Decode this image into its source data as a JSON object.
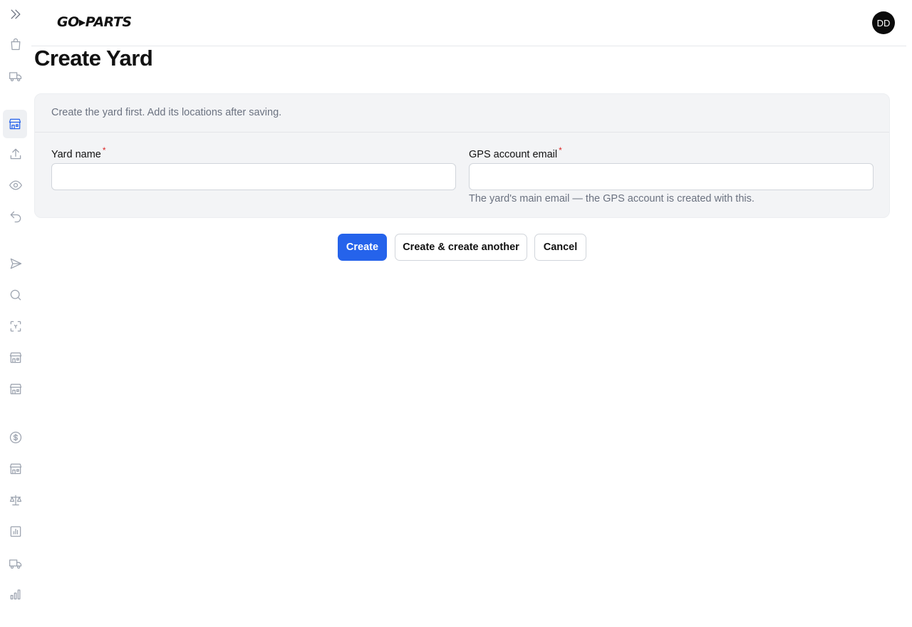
{
  "app": {
    "logo_text": "GO▸PARTS",
    "user_initials": "DD"
  },
  "sidebar": {
    "items": [
      {
        "icon": "chevrons-right-icon",
        "name": "sidebar-toggle"
      },
      {
        "icon": "shopping-bag-icon",
        "name": "sidebar-item-orders"
      },
      {
        "icon": "truck-icon",
        "name": "sidebar-item-shipping"
      },
      {
        "icon": "storefront-icon",
        "name": "sidebar-item-yards",
        "active": true
      },
      {
        "icon": "upload-icon",
        "name": "sidebar-item-upload"
      },
      {
        "icon": "eye-icon",
        "name": "sidebar-item-watch"
      },
      {
        "icon": "undo-icon",
        "name": "sidebar-item-returns"
      },
      {
        "icon": "send-icon",
        "name": "sidebar-item-send"
      },
      {
        "icon": "search-icon",
        "name": "sidebar-item-search"
      },
      {
        "icon": "scan-icon",
        "name": "sidebar-item-scan"
      },
      {
        "icon": "storefront-icon",
        "name": "sidebar-item-store-2"
      },
      {
        "icon": "storefront-icon",
        "name": "sidebar-item-store-3"
      },
      {
        "icon": "dollar-circle-icon",
        "name": "sidebar-item-payments"
      },
      {
        "icon": "storefront-icon",
        "name": "sidebar-item-store-4"
      },
      {
        "icon": "scale-icon",
        "name": "sidebar-item-disputes"
      },
      {
        "icon": "bar-chart-icon",
        "name": "sidebar-item-reports"
      },
      {
        "icon": "truck-icon",
        "name": "sidebar-item-delivery"
      },
      {
        "icon": "bar-chart-2-icon",
        "name": "sidebar-item-analytics"
      }
    ]
  },
  "page": {
    "title": "Create Yard"
  },
  "form": {
    "description": "Create the yard first. Add its locations after saving.",
    "yard_name": {
      "label": "Yard name",
      "required_mark": "*",
      "value": ""
    },
    "gps_email": {
      "label": "GPS account email",
      "required_mark": "*",
      "value": "",
      "help": "The yard's main email — the GPS account is created with this."
    }
  },
  "actions": {
    "create": "Create",
    "create_another": "Create & create another",
    "cancel": "Cancel"
  },
  "colors": {
    "primary": "#2563eb",
    "required": "#dc2626",
    "card_bg": "#f3f4f6"
  }
}
